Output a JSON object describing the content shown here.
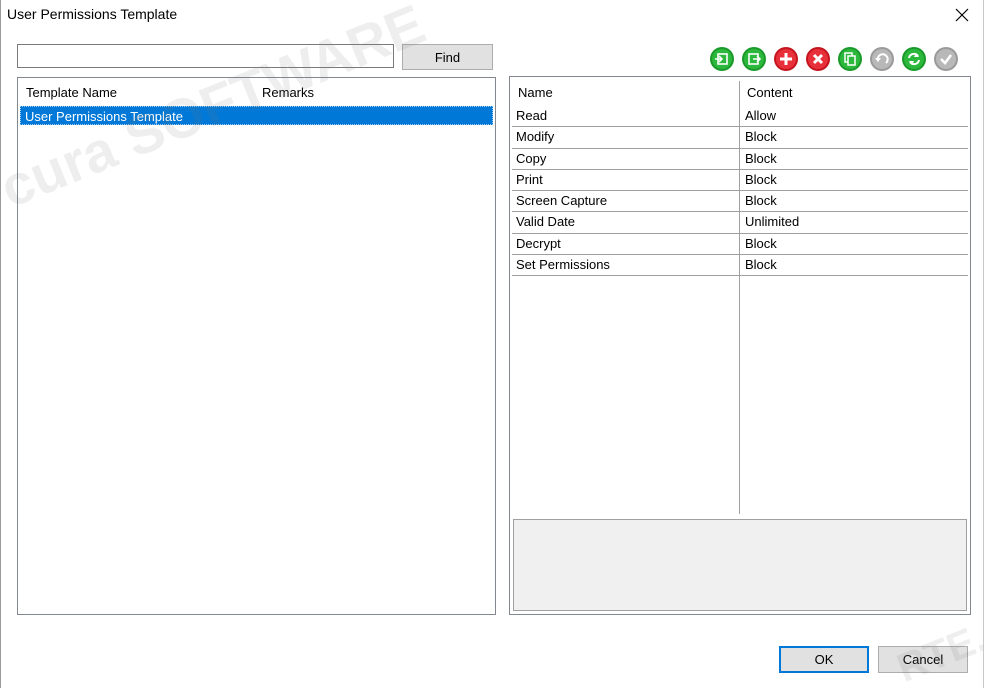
{
  "window": {
    "title": "User Permissions Template"
  },
  "search": {
    "value": "",
    "placeholder": "",
    "find_label": "Find"
  },
  "toolbar": {
    "icons": [
      {
        "name": "import-icon",
        "color": "#1a9a2a"
      },
      {
        "name": "export-icon",
        "color": "#1a9a2a"
      },
      {
        "name": "add-icon",
        "color": "#e0202a"
      },
      {
        "name": "delete-icon",
        "color": "#e0202a"
      },
      {
        "name": "copy-icon",
        "color": "#1a9a2a"
      },
      {
        "name": "undo-icon",
        "color": "#a8a8a8"
      },
      {
        "name": "refresh-icon",
        "color": "#1a9a2a"
      },
      {
        "name": "apply-icon",
        "color": "#a8a8a8"
      }
    ]
  },
  "templates": {
    "columns": [
      "Template Name",
      "Remarks"
    ],
    "rows": [
      {
        "name": "User Permissions Template",
        "remarks": "",
        "selected": true
      }
    ]
  },
  "permissions": {
    "columns": [
      "Name",
      "Content"
    ],
    "rows": [
      {
        "name": "Read",
        "content": "Allow"
      },
      {
        "name": "Modify",
        "content": "Block"
      },
      {
        "name": "Copy",
        "content": "Block"
      },
      {
        "name": "Print",
        "content": "Block"
      },
      {
        "name": "Screen Capture",
        "content": "Block"
      },
      {
        "name": "Valid Date",
        "content": "Unlimited"
      },
      {
        "name": "Decrypt",
        "content": "Block"
      },
      {
        "name": "Set Permissions",
        "content": "Block"
      }
    ]
  },
  "footer": {
    "ok_label": "OK",
    "cancel_label": "Cancel"
  },
  "watermark": {
    "text": "cura SOFTWARE",
    "text2": "RTE."
  },
  "colors": {
    "selection": "#0078d7",
    "button_face": "#e1e1e1",
    "default_button_border": "#0078d7"
  }
}
